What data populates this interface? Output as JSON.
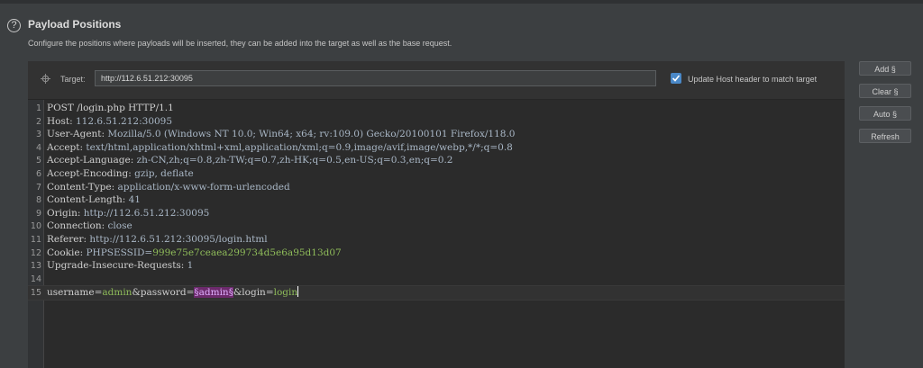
{
  "section": {
    "title": "Payload Positions",
    "description": "Configure the positions where payloads will be inserted, they can be added into the target as well as the base request."
  },
  "target": {
    "label": "Target:",
    "value": "http://112.6.51.212:30095",
    "update_host_label": "Update Host header to match target",
    "update_host_checked": true
  },
  "buttons": {
    "add": "Add §",
    "clear": "Clear §",
    "auto": "Auto §",
    "refresh": "Refresh"
  },
  "request_lines": [
    {
      "n": "1",
      "k": "POST /login.php HTTP/1.1",
      "v": ""
    },
    {
      "n": "2",
      "k": "Host:",
      "v": " 112.6.51.212:30095"
    },
    {
      "n": "3",
      "k": "User-Agent:",
      "v": " Mozilla/5.0 (Windows NT 10.0; Win64; x64; rv:109.0) Gecko/20100101 Firefox/118.0"
    },
    {
      "n": "4",
      "k": "Accept:",
      "v": " text/html,application/xhtml+xml,application/xml;q=0.9,image/avif,image/webp,*/*;q=0.8"
    },
    {
      "n": "5",
      "k": "Accept-Language:",
      "v": " zh-CN,zh;q=0.8,zh-TW;q=0.7,zh-HK;q=0.5,en-US;q=0.3,en;q=0.2"
    },
    {
      "n": "6",
      "k": "Accept-Encoding:",
      "v": " gzip, deflate"
    },
    {
      "n": "7",
      "k": "Content-Type:",
      "v": " application/x-www-form-urlencoded"
    },
    {
      "n": "8",
      "k": "Content-Length:",
      "v": " 41"
    },
    {
      "n": "9",
      "k": "Origin:",
      "v": " http://112.6.51.212:30095"
    },
    {
      "n": "10",
      "k": "Connection:",
      "v": " close"
    },
    {
      "n": "11",
      "k": "Referer:",
      "v": " http://112.6.51.212:30095/login.html"
    },
    {
      "n": "12",
      "k": "Cookie:",
      "v": " PHPSESSID=",
      "v2": "999e75e7ceaea299734d5e6a95d13d07"
    },
    {
      "n": "13",
      "k": "Upgrade-Insecure-Requests:",
      "v": " 1"
    },
    {
      "n": "14",
      "k": "",
      "v": ""
    }
  ],
  "body_line": {
    "n": "15",
    "p1": "username=",
    "p2": "admin",
    "p3": "&password=",
    "marker": "§admin§",
    "p4": "&login=",
    "p5": "login"
  },
  "colors": {
    "payload_marker_bg": "#6c2a6c",
    "value_green": "#8fbc5a",
    "checkbox_blue": "#4a88c7"
  }
}
